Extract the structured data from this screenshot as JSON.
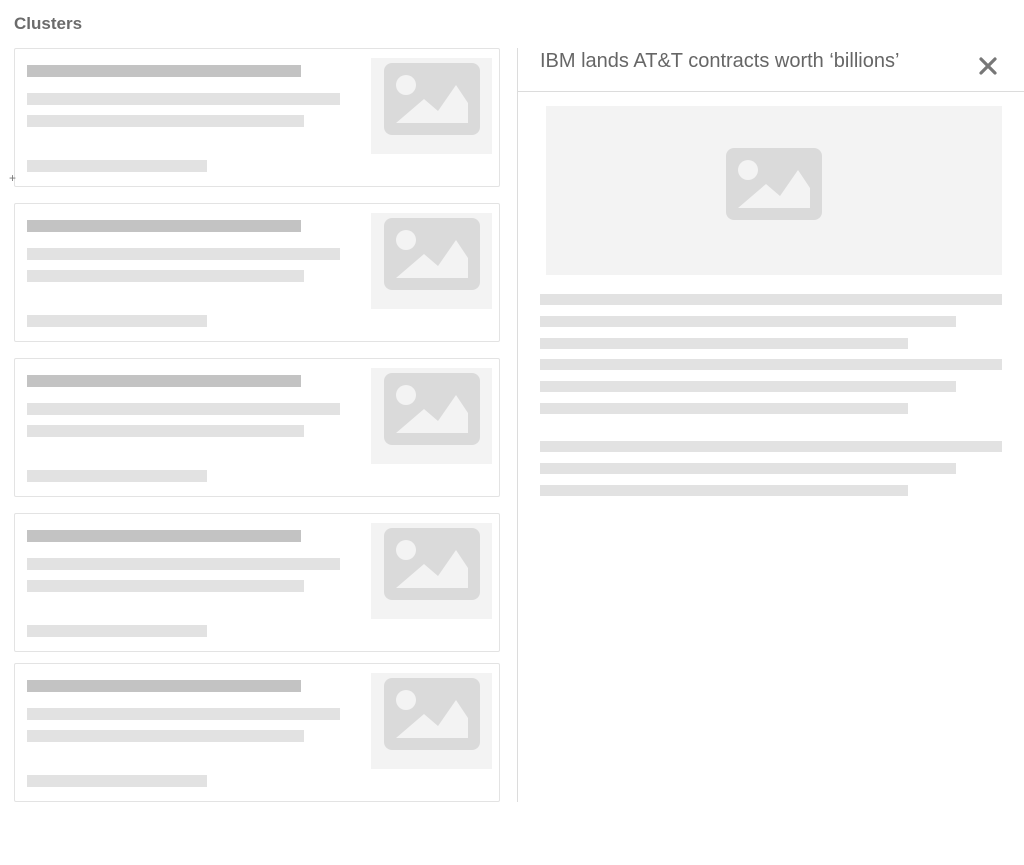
{
  "header": {
    "title": "Clusters"
  },
  "cluster_list": {
    "card_count": 5,
    "cards": [
      {
        "state": "loading-placeholder",
        "has_thumbnail": true
      },
      {
        "state": "loading-placeholder",
        "has_thumbnail": true
      },
      {
        "state": "loading-placeholder",
        "has_thumbnail": true
      },
      {
        "state": "loading-placeholder",
        "has_thumbnail": true
      },
      {
        "state": "loading-placeholder",
        "has_thumbnail": true
      }
    ],
    "cursor_glyph": "+"
  },
  "detail": {
    "title": "IBM lands AT&T contracts worth ‘billions’",
    "close_icon": "close-icon",
    "close_glyph": "✕",
    "hero_icon": "image-placeholder-icon",
    "body_state": "loading-placeholder"
  },
  "colors": {
    "placeholder_dark": "#c3c3c3",
    "placeholder_light": "#e2e2e2",
    "thumbnail_bg": "#f3f3f3",
    "icon_gray": "#dadada",
    "border": "#e3e3e3",
    "text_gray": "#666666"
  }
}
